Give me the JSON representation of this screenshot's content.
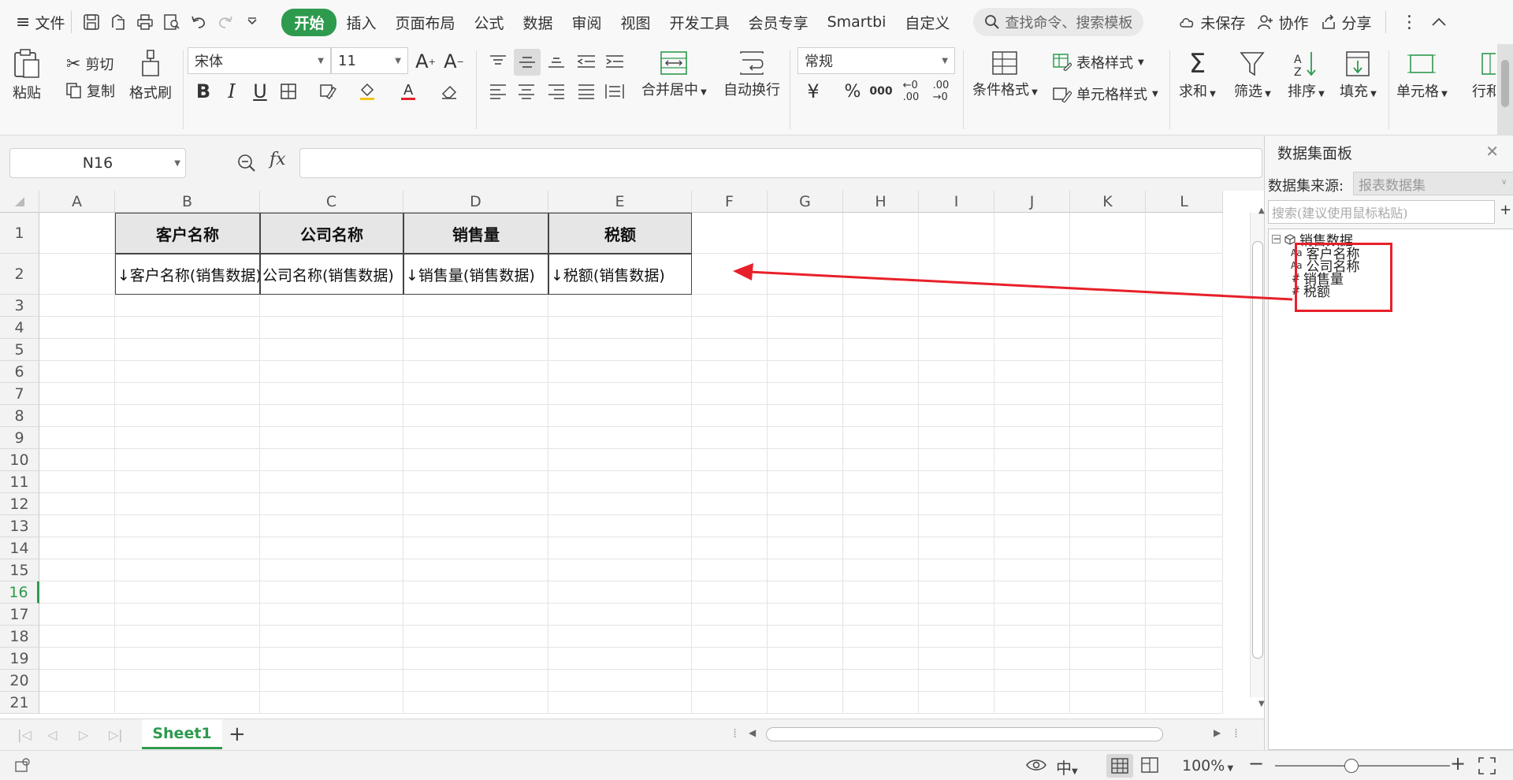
{
  "menubar": {
    "file_label": "文件",
    "tabs": [
      "开始",
      "插入",
      "页面布局",
      "公式",
      "数据",
      "审阅",
      "视图",
      "开发工具",
      "会员专享",
      "Smartbi",
      "自定义"
    ],
    "search_placeholder": "查找命令、搜索模板",
    "unsaved_label": "未保存",
    "collab_label": "协作",
    "share_label": "分享"
  },
  "ribbon": {
    "paste": "粘贴",
    "cut": "剪切",
    "copy": "复制",
    "format_painter": "格式刷",
    "font_name": "宋体",
    "font_size": "11",
    "merge_center": "合并居中",
    "wrap_text": "自动换行",
    "number_format": "常规",
    "conditional_format": "条件格式",
    "table_style": "表格样式",
    "cell_style": "单元格样式",
    "sum": "求和",
    "filter": "筛选",
    "sort": "排序",
    "fill": "填充",
    "cell": "单元格",
    "row_col": "行和列"
  },
  "formula_bar": {
    "cell_ref": "N16",
    "fx": "fx",
    "value": ""
  },
  "grid": {
    "columns": [
      "A",
      "B",
      "C",
      "D",
      "E",
      "F",
      "G",
      "H",
      "I",
      "J",
      "K",
      "L"
    ],
    "rows": [
      "1",
      "2",
      "3",
      "4",
      "5",
      "6",
      "7",
      "8",
      "9",
      "10",
      "11",
      "12",
      "13",
      "14",
      "15",
      "16",
      "17",
      "18",
      "19",
      "20",
      "21"
    ],
    "selected_row": "16",
    "headers": [
      "客户名称",
      "公司名称",
      "销售量",
      "税额"
    ],
    "fields": [
      "↓客户名称(销售数据)",
      "公司名称(销售数据)",
      "↓销售量(销售数据)",
      "↓税额(销售数据)"
    ]
  },
  "sheets": {
    "active": "Sheet1",
    "add": "+"
  },
  "status": {
    "zoom": "100%"
  },
  "panel": {
    "title": "数据集面板",
    "source_label": "数据集来源:",
    "source_value": "报表数据集",
    "search_placeholder": "搜索(建议使用鼠标粘贴)",
    "add": "+",
    "root": "销售数据",
    "items": [
      {
        "icon": "Aa",
        "label": "客户名称"
      },
      {
        "icon": "Aa",
        "label": "公司名称"
      },
      {
        "icon": "#",
        "label": "销售量"
      },
      {
        "icon": "#",
        "label": "税额"
      }
    ]
  },
  "colors": {
    "accent": "#2e9a4e",
    "annotation": "#e8202a"
  }
}
